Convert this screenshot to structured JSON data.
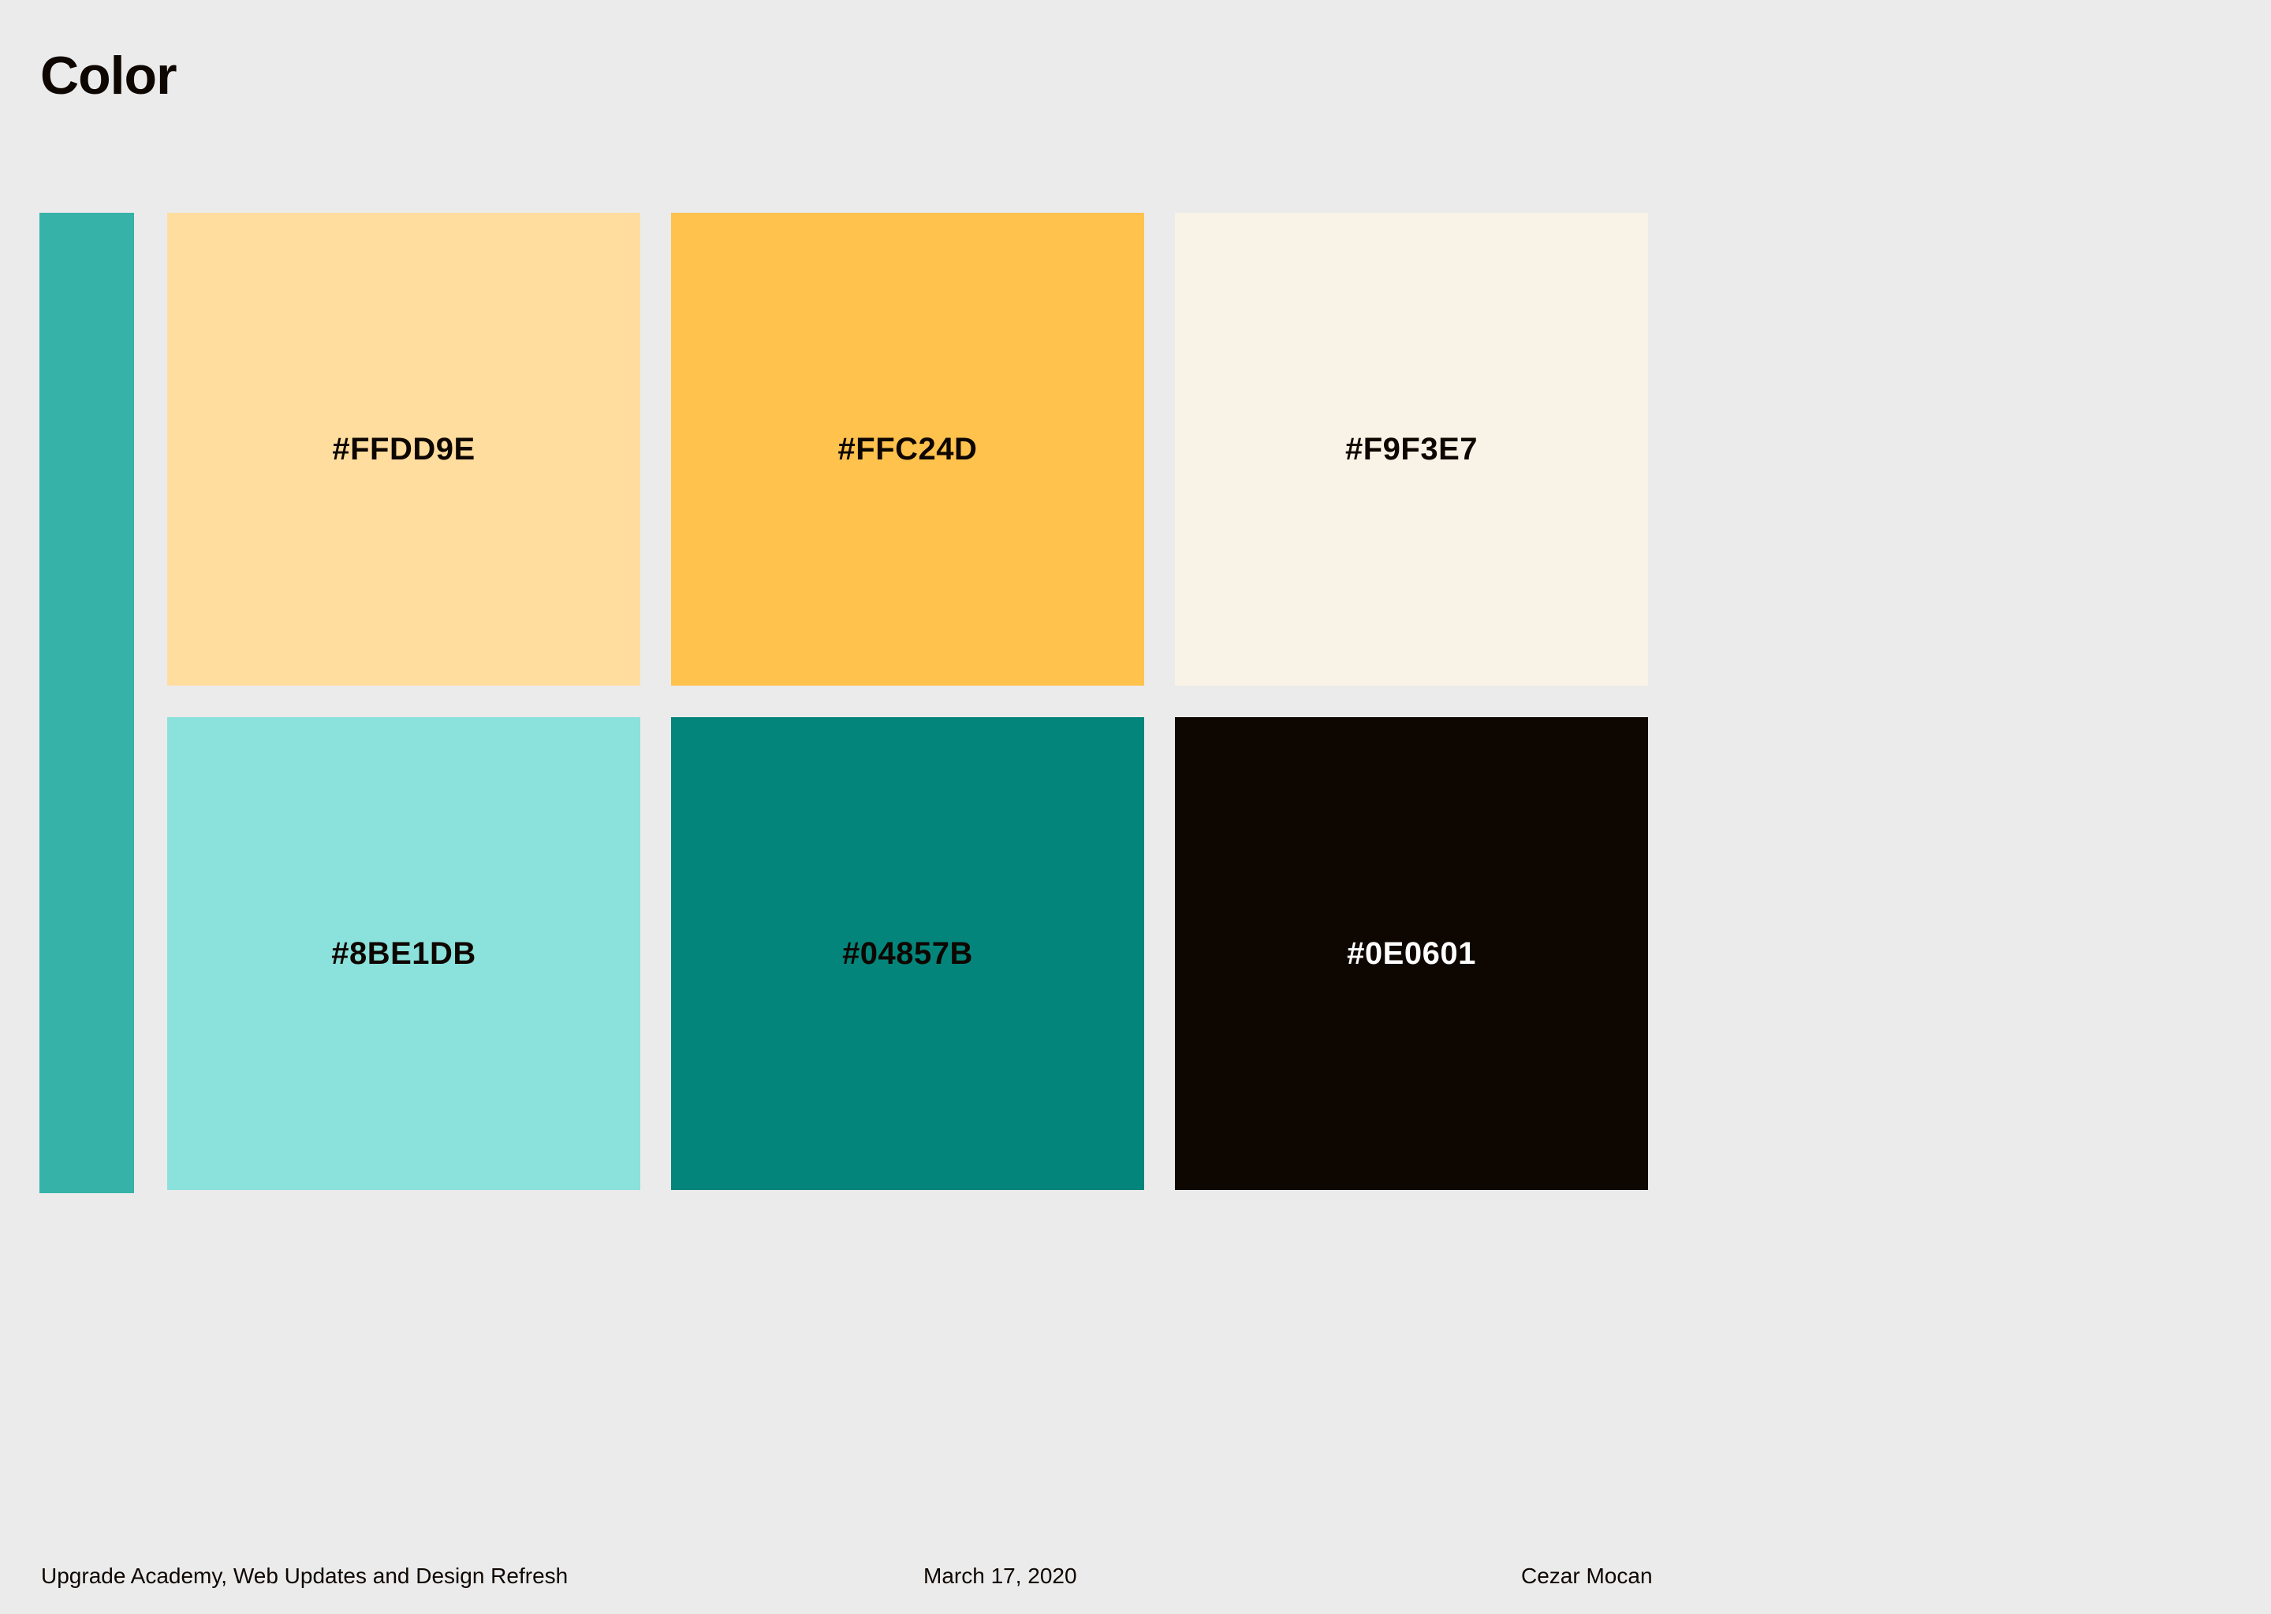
{
  "page": {
    "title": "Color",
    "accent_bar_color": "#36B2A8"
  },
  "swatches": [
    {
      "label": "#FFDD9E",
      "color": "#FFDD9E",
      "text_color": "#0E0601"
    },
    {
      "label": "#FFC24D",
      "color": "#FFC24D",
      "text_color": "#0E0601"
    },
    {
      "label": "#F9F3E7",
      "color": "#F9F3E7",
      "text_color": "#0E0601"
    },
    {
      "label": "#8BE1DB",
      "color": "#8BE1DB",
      "text_color": "#0E0601"
    },
    {
      "label": "#04857B",
      "color": "#04857B",
      "text_color": "#0E0601"
    },
    {
      "label": "#0E0601",
      "color": "#0E0601",
      "text_color": "#FFFFFF"
    }
  ],
  "footer": {
    "project": "Upgrade Academy, Web Updates and Design Refresh",
    "date": "March 17, 2020",
    "author": "Cezar Mocan"
  }
}
